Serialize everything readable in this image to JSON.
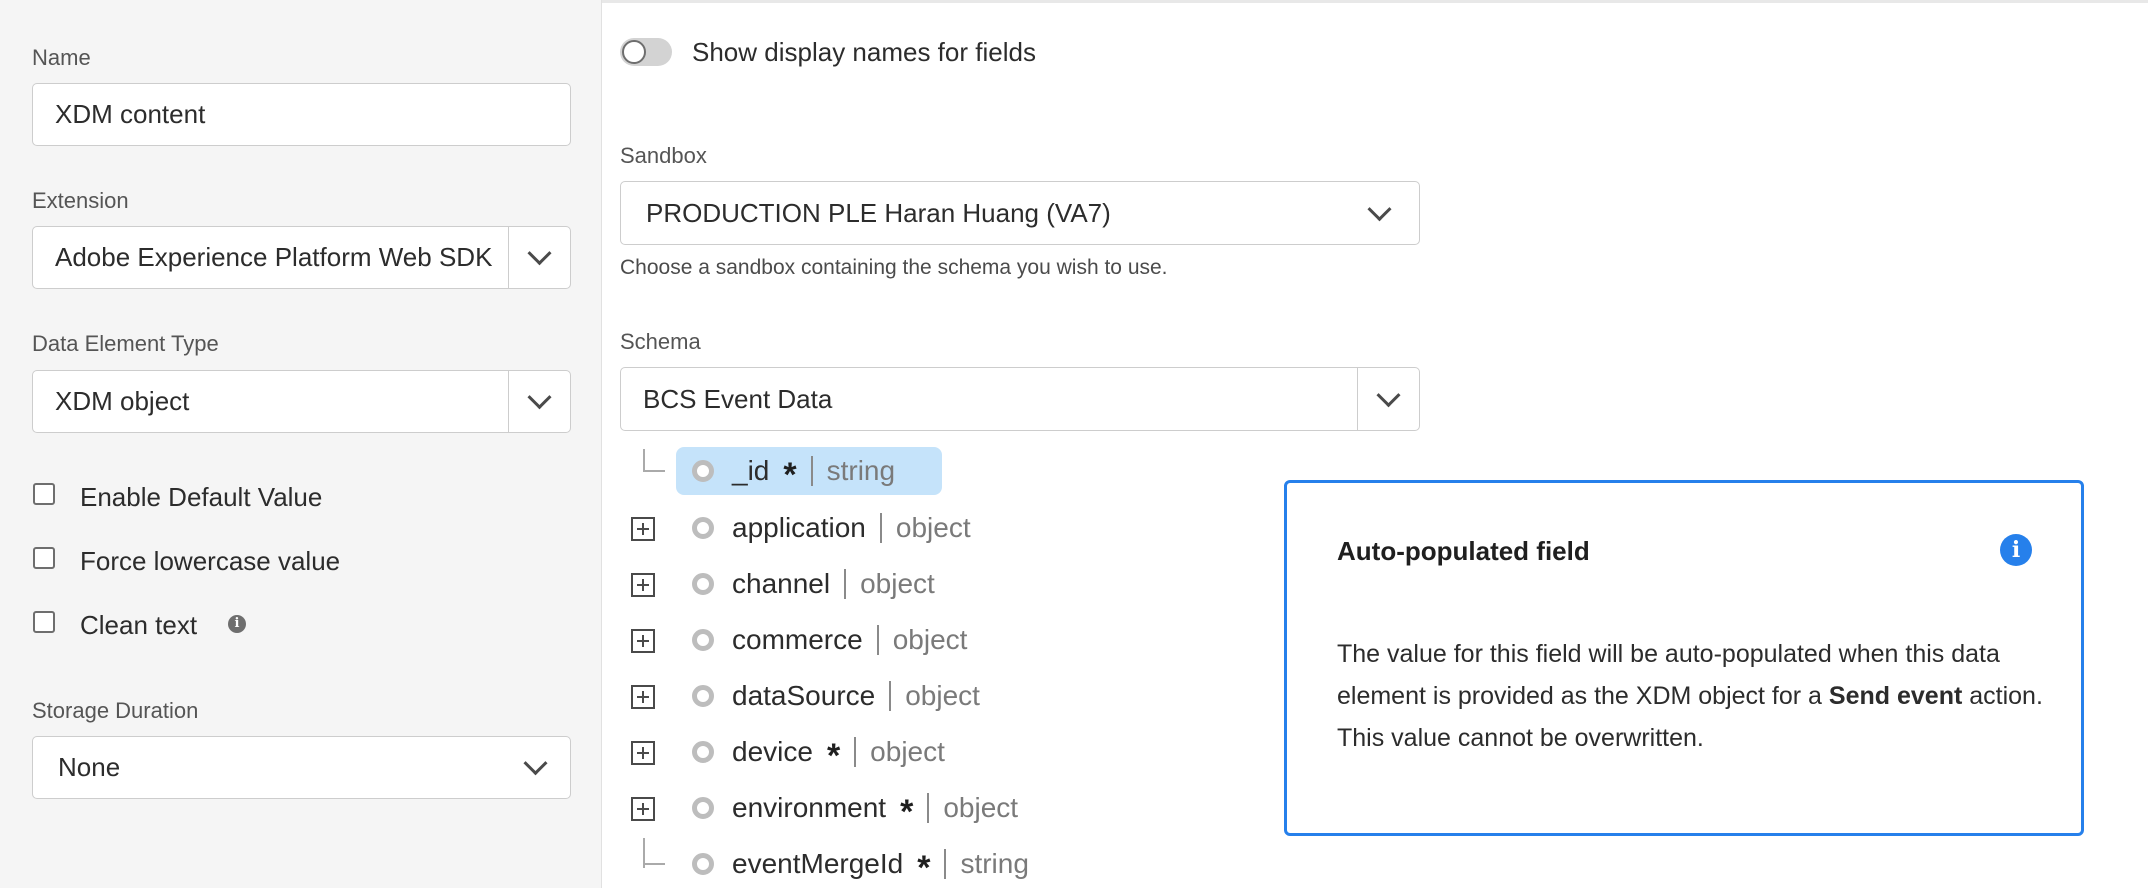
{
  "sidebar": {
    "name_label": "Name",
    "name_value": "XDM content",
    "extension_label": "Extension",
    "extension_value": "Adobe Experience Platform Web SDK",
    "type_label": "Data Element Type",
    "type_value": "XDM object",
    "checkboxes": [
      {
        "label": "Enable Default Value",
        "checked": false
      },
      {
        "label": "Force lowercase value",
        "checked": false
      },
      {
        "label": "Clean text",
        "checked": false
      }
    ],
    "storage_label": "Storage Duration",
    "storage_value": "None"
  },
  "main": {
    "toggle_label": "Show display names for fields",
    "toggle_on": false,
    "sandbox_label": "Sandbox",
    "sandbox_value": "PRODUCTION PLE Haran Huang (VA7)",
    "sandbox_help": "Choose a sandbox containing the schema you wish to use.",
    "schema_label": "Schema",
    "schema_value": "BCS Event Data",
    "tree": [
      {
        "name": "_id",
        "required": true,
        "type": "string",
        "expandable": false,
        "selected": true
      },
      {
        "name": "application",
        "required": false,
        "type": "object",
        "expandable": true
      },
      {
        "name": "channel",
        "required": false,
        "type": "object",
        "expandable": true
      },
      {
        "name": "commerce",
        "required": false,
        "type": "object",
        "expandable": true
      },
      {
        "name": "dataSource",
        "required": false,
        "type": "object",
        "expandable": true
      },
      {
        "name": "device",
        "required": true,
        "type": "object",
        "expandable": true
      },
      {
        "name": "environment",
        "required": true,
        "type": "object",
        "expandable": true
      },
      {
        "name": "eventMergeId",
        "required": true,
        "type": "string",
        "expandable": false
      }
    ]
  },
  "popover": {
    "title": "Auto-populated field",
    "body_pre": "The value for this field will be auto-populated when this data element is provided as the XDM object for a ",
    "body_bold": "Send event",
    "body_post": " action. This value cannot be overwritten."
  },
  "colors": {
    "accent": "#2680eb",
    "selection": "#c5e3fa",
    "sidebar_bg": "#f5f5f5"
  },
  "icons": {
    "info": "info-icon",
    "chevron": "chevron-down-icon",
    "expand": "plus-square-icon"
  }
}
